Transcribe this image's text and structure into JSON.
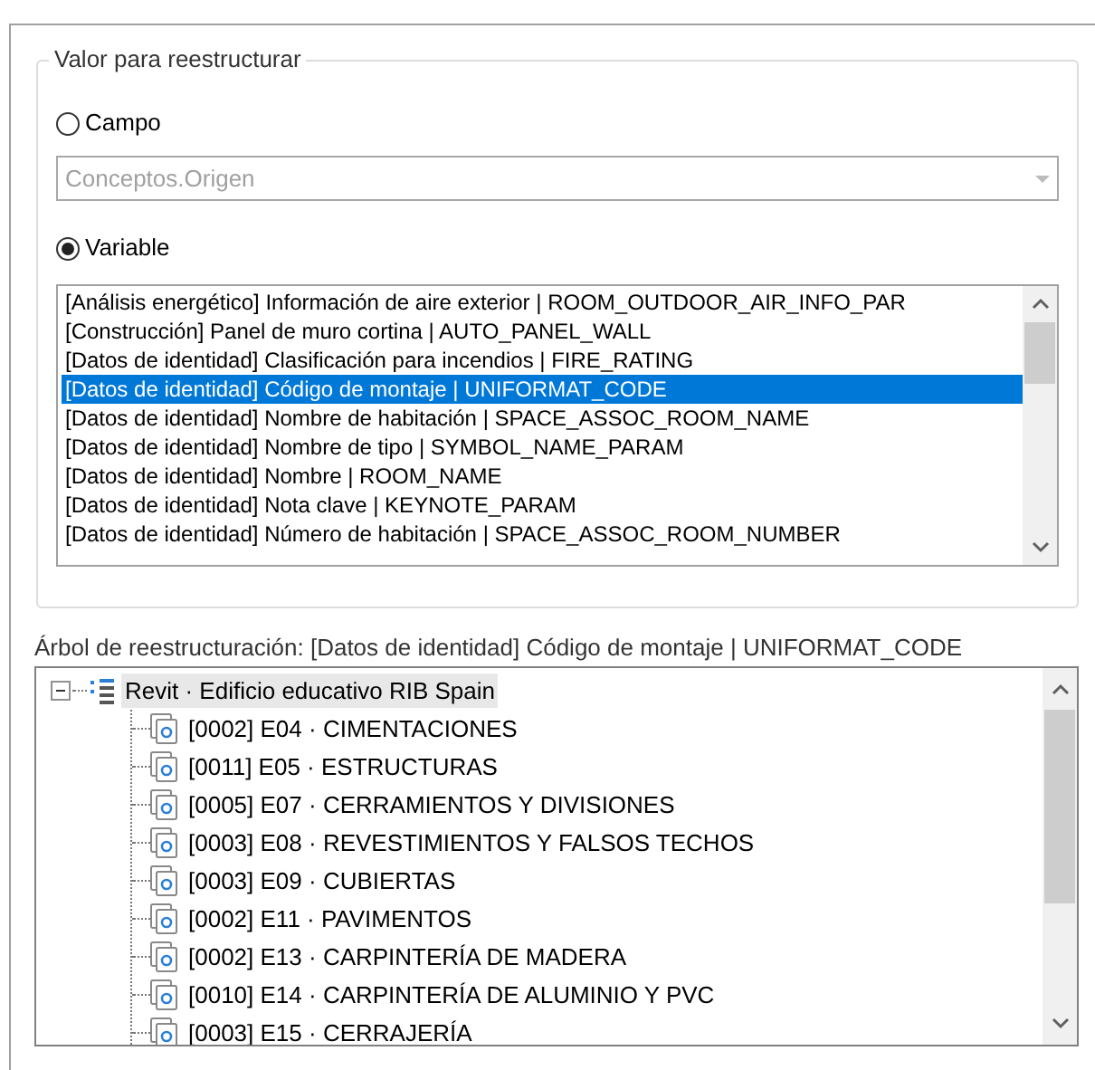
{
  "group": {
    "title": "Valor para reestructurar"
  },
  "options": [
    {
      "label": "Campo",
      "selected": false
    },
    {
      "label": "Variable",
      "selected": true
    }
  ],
  "field_combo": {
    "value": "Conceptos.Origen",
    "disabled": true
  },
  "variables": [
    {
      "text": "[Análisis energético] Información de aire exterior | ROOM_OUTDOOR_AIR_INFO_PAR",
      "selected": false
    },
    {
      "text": "[Construcción] Panel de muro cortina | AUTO_PANEL_WALL",
      "selected": false
    },
    {
      "text": "[Datos de identidad] Clasificación para incendios | FIRE_RATING",
      "selected": false
    },
    {
      "text": "[Datos de identidad] Código de montaje | UNIFORMAT_CODE",
      "selected": true
    },
    {
      "text": "[Datos de identidad] Nombre de habitación | SPACE_ASSOC_ROOM_NAME",
      "selected": false
    },
    {
      "text": "[Datos de identidad] Nombre de tipo | SYMBOL_NAME_PARAM",
      "selected": false
    },
    {
      "text": "[Datos de identidad] Nombre | ROOM_NAME",
      "selected": false
    },
    {
      "text": "[Datos de identidad] Nota clave | KEYNOTE_PARAM",
      "selected": false
    },
    {
      "text": "[Datos de identidad] Número de habitación | SPACE_ASSOC_ROOM_NUMBER",
      "selected": false
    }
  ],
  "tree_label": "Árbol de reestructuración: [Datos de identidad] Código de montaje | UNIFORMAT_CODE",
  "tree": {
    "label": "Revit · Edificio educativo RIB Spain",
    "expanded": true,
    "children": [
      {
        "label": "[0002] E04 · CIMENTACIONES"
      },
      {
        "label": "[0011] E05 · ESTRUCTURAS"
      },
      {
        "label": "[0005] E07 · CERRAMIENTOS Y DIVISIONES"
      },
      {
        "label": "[0003] E08 · REVESTIMIENTOS Y FALSOS TECHOS"
      },
      {
        "label": "[0003] E09 · CUBIERTAS"
      },
      {
        "label": "[0002] E11 · PAVIMENTOS"
      },
      {
        "label": "[0002] E13 · CARPINTERÍA DE MADERA"
      },
      {
        "label": "[0010] E14 · CARPINTERÍA DE ALUMINIO Y PVC"
      },
      {
        "label": "[0003] E15 · CERRAJERÍA"
      }
    ]
  }
}
